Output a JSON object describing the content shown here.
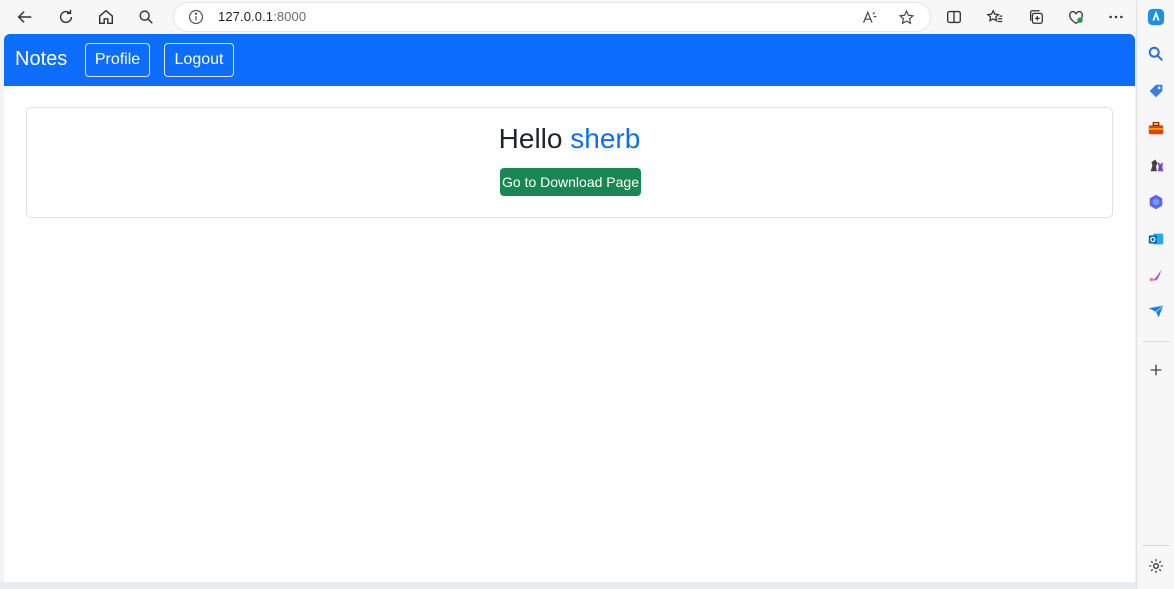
{
  "browser": {
    "url_host": "127.0.0.1",
    "url_port": ":8000"
  },
  "navbar": {
    "brand": "Notes",
    "profile_label": "Profile",
    "logout_label": "Logout",
    "background": "#0d6efd"
  },
  "card": {
    "greeting_prefix": "Hello ",
    "username": "sherb",
    "download_button_label": "Go to Download Page",
    "download_button_color": "#198754"
  },
  "sidebar": {
    "icons": [
      "search-icon",
      "tag-icon",
      "toolbox-icon",
      "chess-icon",
      "copilot-hex-icon",
      "outlook-icon",
      "designer-icon",
      "send-icon",
      "add-icon",
      "settings-icon"
    ]
  }
}
